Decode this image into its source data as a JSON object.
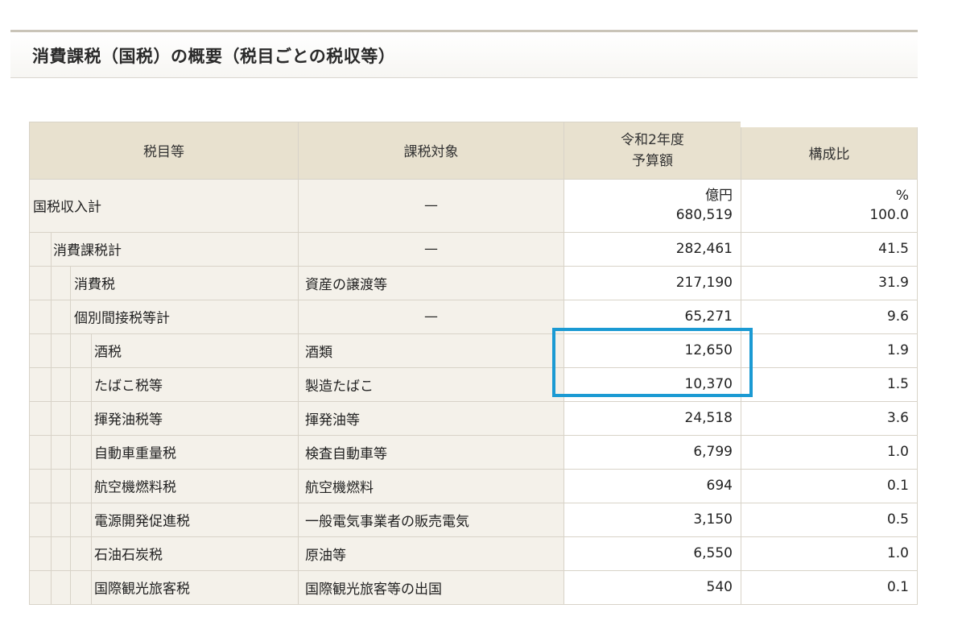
{
  "title": "消費課税（国税）の概要（税目ごとの税収等）",
  "headers": {
    "col1": "税目等",
    "col2": "課税対象",
    "col3_line1": "令和2年度",
    "col3_line2": "予算額",
    "col4": "構成比"
  },
  "rows": [
    {
      "label": "国税収入計",
      "object": "—",
      "unit": "億円",
      "amount": "680,519",
      "pct_unit": "%",
      "pct": "100.0"
    },
    {
      "label": "消費課税計",
      "object": "—",
      "amount": "282,461",
      "pct": "41.5"
    },
    {
      "label": "消費税",
      "object": "資産の譲渡等",
      "amount": "217,190",
      "pct": "31.9"
    },
    {
      "label": "個別間接税等計",
      "object": "—",
      "amount": "65,271",
      "pct": "9.6"
    },
    {
      "label": "酒税",
      "object": "酒類",
      "amount": "12,650",
      "pct": "1.9"
    },
    {
      "label": "たばこ税等",
      "object": "製造たばこ",
      "amount": "10,370",
      "pct": "1.5"
    },
    {
      "label": "揮発油税等",
      "object": "揮発油等",
      "amount": "24,518",
      "pct": "3.6"
    },
    {
      "label": "自動車重量税",
      "object": "検査自動車等",
      "amount": "6,799",
      "pct": "1.0"
    },
    {
      "label": "航空機燃料税",
      "object": "航空機燃料",
      "amount": "694",
      "pct": "0.1"
    },
    {
      "label": "電源開発促進税",
      "object": "一般電気事業者の販売電気",
      "amount": "3,150",
      "pct": "0.5"
    },
    {
      "label": "石油石炭税",
      "object": "原油等",
      "amount": "6,550",
      "pct": "1.0"
    },
    {
      "label": "国際観光旅客税",
      "object": "国際観光旅客等の出国",
      "amount": "540",
      "pct": "0.1"
    }
  ],
  "highlight_color": "#1b9ad3"
}
